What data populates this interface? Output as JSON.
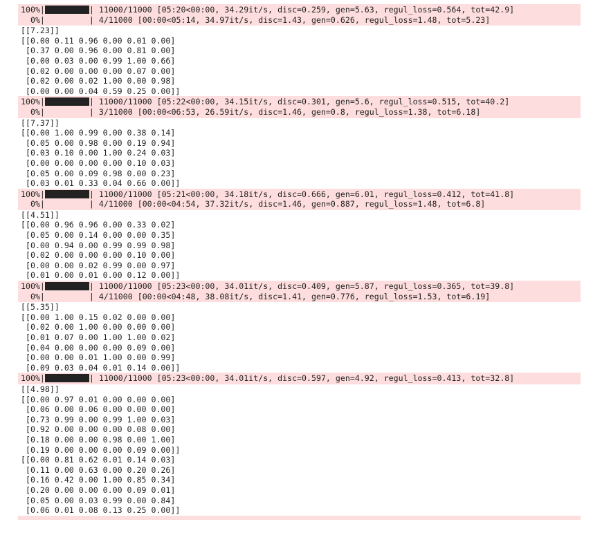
{
  "colors": {
    "stderr_background": "#fddddd",
    "text": "#222222",
    "progress_fill": "#222222"
  },
  "blocks": [
    {
      "bars": [
        {
          "percent": "100%",
          "filled_fraction": 1.0,
          "stats": "11000/11000 [05:20<00:00, 34.29it/s, disc=0.259, gen=5.63, regul_loss=0.564, tot=42.9]"
        },
        {
          "percent": "  0%",
          "filled_fraction": 0.0,
          "stats": "4/11000 [00:00<05:14, 34.97it/s, disc=1.43, gen=0.626, regul_loss=1.48, tot=5.23]"
        }
      ],
      "lines": [
        "[[7.23]]",
        "[[0.00 0.11 0.96 0.00 0.01 0.00]",
        " [0.37 0.00 0.96 0.00 0.81 0.00]",
        " [0.00 0.03 0.00 0.99 1.00 0.66]",
        " [0.02 0.00 0.00 0.00 0.07 0.00]",
        " [0.02 0.00 0.02 1.00 0.00 0.98]",
        " [0.00 0.00 0.04 0.59 0.25 0.00]]"
      ]
    },
    {
      "bars": [
        {
          "percent": "100%",
          "filled_fraction": 1.0,
          "stats": "11000/11000 [05:22<00:00, 34.15it/s, disc=0.301, gen=5.6, regul_loss=0.515, tot=40.2]"
        },
        {
          "percent": "  0%",
          "filled_fraction": 0.0,
          "stats": "3/11000 [00:00<06:53, 26.59it/s, disc=1.46, gen=0.8, regul_loss=1.38, tot=6.18]"
        }
      ],
      "lines": [
        "[[7.37]]",
        "[[0.00 1.00 0.99 0.00 0.38 0.14]",
        " [0.05 0.00 0.98 0.00 0.19 0.94]",
        " [0.03 0.10 0.00 1.00 0.24 0.03]",
        " [0.00 0.00 0.00 0.00 0.10 0.03]",
        " [0.05 0.00 0.09 0.98 0.00 0.23]",
        " [0.03 0.01 0.33 0.04 0.66 0.00]]"
      ]
    },
    {
      "bars": [
        {
          "percent": "100%",
          "filled_fraction": 1.0,
          "stats": "11000/11000 [05:21<00:00, 34.18it/s, disc=0.666, gen=6.01, regul_loss=0.412, tot=41.8]"
        },
        {
          "percent": "  0%",
          "filled_fraction": 0.0,
          "stats": "4/11000 [00:00<04:54, 37.32it/s, disc=1.46, gen=0.887, regul_loss=1.48, tot=6.8]"
        }
      ],
      "lines": [
        "[[4.51]]",
        "[[0.00 0.96 0.96 0.00 0.33 0.02]",
        " [0.05 0.00 0.14 0.00 0.00 0.35]",
        " [0.00 0.94 0.00 0.99 0.99 0.98]",
        " [0.02 0.00 0.00 0.00 0.10 0.00]",
        " [0.00 0.00 0.02 0.99 0.00 0.97]",
        " [0.01 0.00 0.01 0.00 0.12 0.00]]"
      ]
    },
    {
      "bars": [
        {
          "percent": "100%",
          "filled_fraction": 1.0,
          "stats": "11000/11000 [05:23<00:00, 34.01it/s, disc=0.409, gen=5.87, regul_loss=0.365, tot=39.8]"
        },
        {
          "percent": "  0%",
          "filled_fraction": 0.0,
          "stats": "4/11000 [00:00<04:48, 38.08it/s, disc=1.41, gen=0.776, regul_loss=1.53, tot=6.19]"
        }
      ],
      "lines": [
        "[[5.35]]",
        "[[0.00 1.00 0.15 0.02 0.00 0.00]",
        " [0.02 0.00 1.00 0.00 0.00 0.00]",
        " [0.01 0.07 0.00 1.00 1.00 0.02]",
        " [0.04 0.00 0.00 0.00 0.09 0.00]",
        " [0.00 0.00 0.01 1.00 0.00 0.99]",
        " [0.09 0.03 0.04 0.01 0.14 0.00]]"
      ]
    },
    {
      "bars": [
        {
          "percent": "100%",
          "filled_fraction": 1.0,
          "stats": "11000/11000 [05:23<00:00, 34.01it/s, disc=0.597, gen=4.92, regul_loss=0.413, tot=32.8]"
        }
      ],
      "lines": [
        "[[4.98]]",
        "[[0.00 0.97 0.01 0.00 0.00 0.00]",
        " [0.06 0.00 0.06 0.00 0.00 0.00]",
        " [0.73 0.99 0.00 0.99 1.00 0.03]",
        " [0.92 0.00 0.00 0.00 0.08 0.00]",
        " [0.18 0.00 0.00 0.98 0.00 1.00]",
        " [0.19 0.00 0.00 0.00 0.09 0.00]]",
        "[[0.00 0.81 0.62 0.01 0.14 0.03]",
        " [0.11 0.00 0.63 0.00 0.20 0.26]",
        " [0.16 0.42 0.00 1.00 0.85 0.34]",
        " [0.20 0.00 0.00 0.00 0.09 0.01]",
        " [0.05 0.00 0.03 0.99 0.00 0.84]",
        " [0.06 0.01 0.08 0.13 0.25 0.00]]"
      ]
    }
  ],
  "trailing_stderr": true
}
